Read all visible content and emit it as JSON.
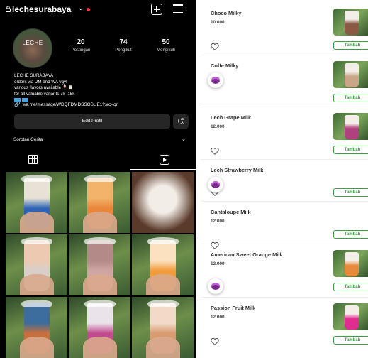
{
  "instagram": {
    "username": "lechesurabaya",
    "chevron_glyph": "⌄",
    "avatar_text": "LECHE",
    "stats": [
      {
        "value": "20",
        "label": "Postingan"
      },
      {
        "value": "74",
        "label": "Pengikut"
      },
      {
        "value": "50",
        "label": "Mengikuti"
      }
    ],
    "bio_lines": [
      "LECHE SURABAYA",
      "orders via DM and WA ygy!",
      "various flavors available 🍷🥛",
      "for all valuable variants 7k -15k"
    ],
    "link": "wa.me/message/WDQFDMDSSOSUE1?src=qr",
    "edit_button": "Edit Profil",
    "add_user_glyph": "+웃",
    "highlights_label": "Sorotan Cerita",
    "highlights_chevron": "⌄",
    "icons": [
      "lock-icon",
      "chevron-down-icon",
      "plus-square-icon",
      "menu-icon",
      "grid-icon",
      "reels-icon",
      "tagged-icon",
      "link-icon",
      "add-user-icon"
    ],
    "accent_color": "#ff3040",
    "photo_colors": [
      [
        "#2f63b5",
        "#e7e2d5"
      ],
      [
        "#e9863a",
        "#f3b36a"
      ],
      [
        "#5a3a2a",
        "#f2ede6"
      ],
      [
        "#d8cfc9",
        "#ecc9b0"
      ],
      [
        "#cfa6a4",
        "#b38a88"
      ],
      [
        "#f19b3b",
        "#fbe1c0"
      ],
      [
        "#c86f3d",
        "#3c6d9c"
      ],
      [
        "#c24a8e",
        "#eae3ea"
      ],
      [
        "#d89a70",
        "#f1dbc8"
      ]
    ]
  },
  "menu": {
    "add_label": "Tambah",
    "accent_color": "#3aa043",
    "items": [
      {
        "name": "Choco Milky",
        "price": "10.000",
        "cart": false,
        "cup_color": "#8a5a45"
      },
      {
        "name": "Coffe Milky",
        "price": "",
        "cart": true,
        "cup_color": "#c9a688"
      },
      {
        "name": "Lech Grape Milk",
        "price": "12.000",
        "cart": false,
        "cup_color": "#b0417f"
      },
      {
        "name": "Lech Strawberry Milk",
        "price": "",
        "cart": true,
        "cup_color": ""
      },
      {
        "name": "Cantaloupe Milk",
        "price": "12.000",
        "cart": false,
        "cup_color": ""
      },
      {
        "name": "American Sweet Orange Milk",
        "price": "12.000",
        "cart": true,
        "cup_color": "#e88a3c"
      },
      {
        "name": "Passion Fruit Milk",
        "price": "12.000",
        "cart": false,
        "cup_color": "#e02b8f"
      }
    ]
  }
}
